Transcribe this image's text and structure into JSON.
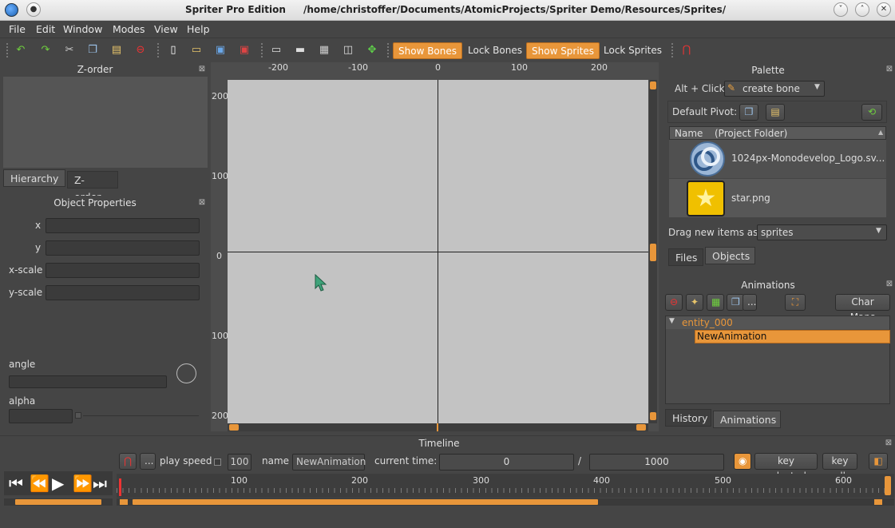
{
  "window": {
    "app_title": "Spriter Pro Edition",
    "path": "/home/christoffer/Documents/AtomicProjects/Spriter Demo/Resources/Sprites/"
  },
  "menu": [
    "File",
    "Edit",
    "Window",
    "Modes",
    "View",
    "Help"
  ],
  "toolbar": {
    "show_bones": "Show Bones",
    "lock_bones": "Lock Bones",
    "show_sprites": "Show Sprites",
    "lock_sprites": "Lock Sprites"
  },
  "zorder": {
    "title": "Z-order",
    "tabs": [
      "Hierarchy",
      "Z-order"
    ]
  },
  "object_properties": {
    "title": "Object Properties",
    "fields": [
      "x",
      "y",
      "x-scale",
      "y-scale"
    ],
    "angle_label": "angle",
    "alpha_label": "alpha"
  },
  "ruler": {
    "top": [
      "-200",
      "-100",
      "0",
      "100",
      "200"
    ],
    "left": [
      "200",
      "100",
      "0",
      "100",
      "200"
    ]
  },
  "palette": {
    "title": "Palette",
    "alt_click_label": "Alt + Click:",
    "alt_click_value": "create bone",
    "default_pivot_label": "Default Pivot:",
    "col_name": "Name",
    "col_folder": "(Project Folder)",
    "files": [
      {
        "name": "1024px-Monodevelop_Logo.sv...",
        "icon": "monodevelop-logo-icon"
      },
      {
        "name": "star.png",
        "icon": "star-icon"
      }
    ],
    "drag_label": "Drag new items as",
    "drag_value": "sprites",
    "tabs": [
      "Files",
      "Objects"
    ]
  },
  "animations": {
    "title": "Animations",
    "char_maps": "Char Maps",
    "more": "...",
    "entity": "entity_000",
    "animation": "NewAnimation",
    "tabs": [
      "History",
      "Animations"
    ]
  },
  "timeline": {
    "title": "Timeline",
    "more": "...",
    "play_speed_label": "play speed",
    "play_speed_value": "100",
    "name_label": "name",
    "name_value": "NewAnimation",
    "current_time_label": "current time:",
    "current_time_value": "0",
    "separator": "/",
    "end_time_value": "1000",
    "key_selected": "key selected",
    "key_all": "key all",
    "ticks": [
      "100",
      "200",
      "300",
      "400",
      "500",
      "600"
    ]
  },
  "colors": {
    "accent": "#e8963a",
    "canvas": "#c3c3c3",
    "panel": "#454545"
  }
}
